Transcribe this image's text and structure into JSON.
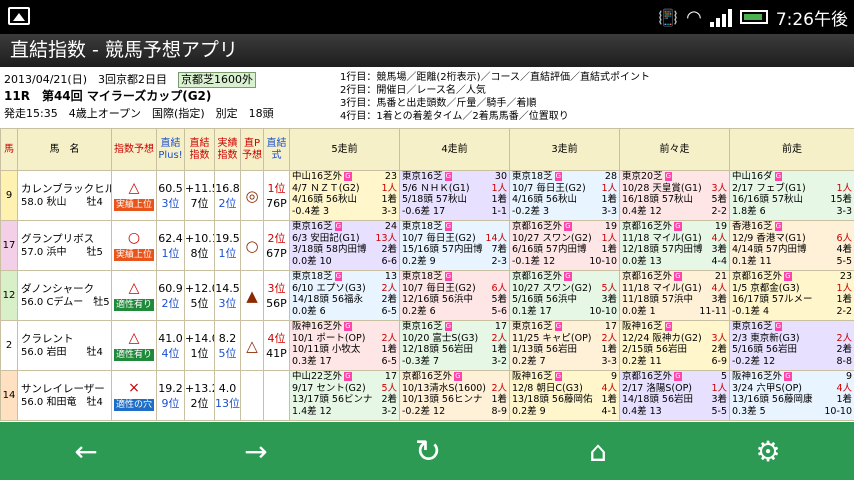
{
  "status": {
    "time": "7:26午後"
  },
  "app": {
    "title": "直結指数 - 競馬予想アプリ"
  },
  "race": {
    "line1": "2013/04/21(日)　3回京都2日目",
    "course": "京都芝1600外",
    "line2": "11R　第44回 マイラーズカップ(G2)",
    "line3": "発走15:35　4歳上オープン　国際(指定)　別定　18頭"
  },
  "legend": [
    "1行目：競馬場／距離(2桁表示)／コース／直結評価／直結式ポイント",
    "2行目：開催日／レース名／人気",
    "3行目：馬番と出走頭数／斤量／騎手／着順",
    "4行目：1着との着差タイム／2着馬馬番／位置取り"
  ],
  "headers": {
    "no": "馬",
    "name": "馬　名",
    "yoso": "指数予想",
    "plus": "直結 Plus!",
    "index": "直結 指数",
    "jisseki": "実績 指数",
    "p": "直P 予想",
    "shiki": "直結 式",
    "r5": "5走前",
    "r4": "4走前",
    "r3": "3走前",
    "r2": "前々走",
    "r1": "前走"
  },
  "horses": [
    {
      "no": "9",
      "name": "カレンブラックヒル",
      "sub": "58.0 秋山　　牡4",
      "mark": "△",
      "tag": "実績上位",
      "tagcolor": "#e8541a",
      "plus": "60.5",
      "plusrk": "3位",
      "idx": "+11.5",
      "idxrk": "7位",
      "jis": "16.8",
      "jisrk": "2位",
      "pmark": "◎",
      "rank": "1位",
      "pt": "76P",
      "races": [
        [
          "中山16芝外",
          "23",
          "4/7 ＮＺＴ(G2)",
          "1人",
          "4/16頭 56秋山",
          "1着",
          "-0.4差 3",
          "3-3"
        ],
        [
          "東京16芝",
          "30",
          "5/6 ＮＨＫ(G1)",
          "1人",
          "5/18頭 57秋山",
          "1着",
          "-0.6差 17",
          "1-1"
        ],
        [
          "東京18芝",
          "28",
          "10/7 毎日王(G2)",
          "1人",
          "4/16頭 56秋山",
          "1着",
          "-0.2差 3",
          "3-3"
        ],
        [
          "東京20芝",
          "",
          "10/28 天皇賞(G1)",
          "3人",
          "16/18頭 57秋山",
          "5着",
          "0.4差 12",
          "2-2"
        ],
        [
          "中山16ダ",
          "",
          "2/17 フェブ(G1)",
          "1人",
          "16/16頭 57秋山",
          "15着",
          "1.8差 6",
          "3-3"
        ]
      ]
    },
    {
      "no": "17",
      "name": "グランプリボス",
      "sub": "57.0 浜中　　牡5",
      "mark": "○",
      "tag": "実績上位",
      "tagcolor": "#e8541a",
      "plus": "62.4",
      "plusrk": "1位",
      "idx": "+10.1",
      "idxrk": "8位",
      "jis": "19.5",
      "jisrk": "1位",
      "pmark": "○",
      "rank": "2位",
      "pt": "67P",
      "races": [
        [
          "東京16芝",
          "24",
          "6/3 安田記(G1)",
          "13人",
          "3/18頭 58内田博",
          "2着",
          "0.0差 10",
          "6-6"
        ],
        [
          "東京18芝",
          "",
          "10/7 毎日王(G2)",
          "14人",
          "15/16頭 57内田博",
          "7着",
          "0.2差 9",
          "2-3"
        ],
        [
          "京都16芝外",
          "19",
          "10/27 スワン(G2)",
          "1人",
          "6/16頭 57内田博",
          "1着",
          "-0.1差 12",
          "10-10"
        ],
        [
          "京都16芝外",
          "19",
          "11/18 マイル(G1)",
          "4人",
          "12/18頭 57内田博",
          "3着",
          "0.0差 13",
          "4-4"
        ],
        [
          "香港16芝",
          "",
          "12/9 香港マ(G1)",
          "6人",
          "4/14頭 57内田博",
          "4着",
          "0.1差 11",
          "5-5"
        ]
      ]
    },
    {
      "no": "12",
      "name": "ダノンシャーク",
      "sub": "56.0 Cデムー　牡5",
      "mark": "△",
      "tag": "適性有り",
      "tagcolor": "#1f8a3a",
      "plus": "60.9",
      "plusrk": "2位",
      "idx": "+12.0",
      "idxrk": "5位",
      "jis": "14.5",
      "jisrk": "3位",
      "pmark": "▲",
      "rank": "3位",
      "pt": "56P",
      "races": [
        [
          "東京18芝",
          "13",
          "6/10 エプソ(G3)",
          "2人",
          "14/18頭 56福永",
          "2着",
          "0.0差 6",
          "6-5"
        ],
        [
          "東京18芝",
          "",
          "10/7 毎日王(G2)",
          "6人",
          "12/16頭 56浜中",
          "5着",
          "0.2差 6",
          "5-6"
        ],
        [
          "京都16芝外",
          "",
          "10/27 スワン(G2)",
          "5人",
          "5/16頭 56浜中",
          "3着",
          "0.1差 17",
          "10-10"
        ],
        [
          "京都16芝外",
          "21",
          "11/18 マイル(G1)",
          "4人",
          "11/18頭 57浜中",
          "3着",
          "0.0差 1",
          "11-11"
        ],
        [
          "京都16芝外",
          "23",
          "1/5 京都金(G3)",
          "1人",
          "16/17頭 57ルメー",
          "1着",
          "-0.1差 4",
          "2-2"
        ]
      ]
    },
    {
      "no": "2",
      "name": "クラレント",
      "sub": "56.0 岩田　　牡4",
      "mark": "△",
      "tag": "適性有り",
      "tagcolor": "#1f8a3a",
      "plus": "41.0",
      "plusrk": "4位",
      "idx": "+14.0",
      "idxrk": "1位",
      "jis": "8.2",
      "jisrk": "5位",
      "pmark": "△",
      "rank": "4位",
      "pt": "41P",
      "races": [
        [
          "阪神16芝外",
          "",
          "10/1 ポート(OP)",
          "2人",
          "10/11頭 小牧太",
          "1着",
          "0.3差 17",
          "6-5"
        ],
        [
          "東京16芝",
          "17",
          "10/20 富士S(G3)",
          "2人",
          "12/18頭 56岩田",
          "1着",
          "-0.3差 7",
          "3-2"
        ],
        [
          "東京16芝",
          "17",
          "11/25 キャピ(OP)",
          "2人",
          "1/13頭 56岩田",
          "1着",
          "0.2差 7",
          "3-3"
        ],
        [
          "阪神16芝",
          "",
          "12/24 阪神カ(G2)",
          "3人",
          "2/15頭 56岩田",
          "2着",
          "0.2差 11",
          "6-9"
        ],
        [
          "東京16芝",
          "",
          "2/3 東京新(G3)",
          "2人",
          "5/16頭 56岩田",
          "2着",
          "-0.2差 12",
          "8-8"
        ]
      ]
    },
    {
      "no": "14",
      "name": "サンレイレーザー",
      "sub": "56.0 和田竜　牡4",
      "mark": "×",
      "tag": "適性の穴",
      "tagcolor": "#1e6ec8",
      "plus": "19.2",
      "plusrk": "9位",
      "idx": "+13.2",
      "idxrk": "2位",
      "jis": "4.0",
      "jisrk": "13位",
      "pmark": "",
      "rank": "",
      "pt": "",
      "races": [
        [
          "中山22芝外",
          "17",
          "9/17 セント(G2)",
          "5人",
          "13/17頭 56ビンナ",
          "2着",
          "1.4差 12",
          "3-2"
        ],
        [
          "京都16芝外",
          "",
          "10/13清水S(1600)",
          "2人",
          "10/13頭 56ヒンナ",
          "1着",
          "-0.2差 12",
          "8-9"
        ],
        [
          "阪神16芝",
          "9",
          "12/8 朝日C(G3)",
          "4人",
          "13/18頭 56藤岡佑",
          "1着",
          "0.2差 9",
          "4-1"
        ],
        [
          "京都16芝外",
          "5",
          "2/17 洛陽S(OP)",
          "1人",
          "14/18頭 56岩田",
          "3着",
          "0.4差 13",
          "5-5"
        ],
        [
          "阪神16芝外",
          "9",
          "3/24 六甲S(OP)",
          "4人",
          "13/16頭 56藤岡康",
          "1着",
          "0.3差 5",
          "10-10"
        ]
      ]
    }
  ]
}
